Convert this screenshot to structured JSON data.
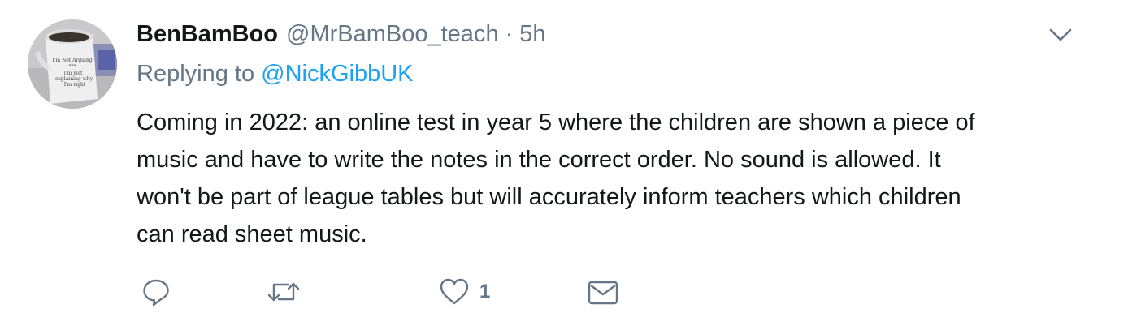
{
  "tweet": {
    "display_name": "BenBamBoo",
    "handle": "@MrBamBoo_teach",
    "separator": "·",
    "time": "5h",
    "replying_prefix": "Replying to",
    "replying_to": "@NickGibbUK",
    "text_lines": [
      "Coming in 2022: an online test in year 5 where the children are shown a piece of",
      "music and have to write the notes in the correct order. No sound is allowed. It",
      "won't be part of league tables but will accurately inform teachers which children",
      "can read sheet music."
    ],
    "avatar": {
      "mug_text_lines": [
        "I'm Not Arguing",
        "***",
        "I'm just",
        "explaining why",
        "I'm right"
      ]
    }
  },
  "actions": {
    "reply_icon": "reply-icon",
    "retweet_icon": "retweet-icon",
    "like_icon": "heart-icon",
    "like_count": "1",
    "dm_icon": "envelope-icon"
  },
  "colors": {
    "text": "#14171a",
    "secondary": "#657786",
    "link": "#1da1f2"
  }
}
